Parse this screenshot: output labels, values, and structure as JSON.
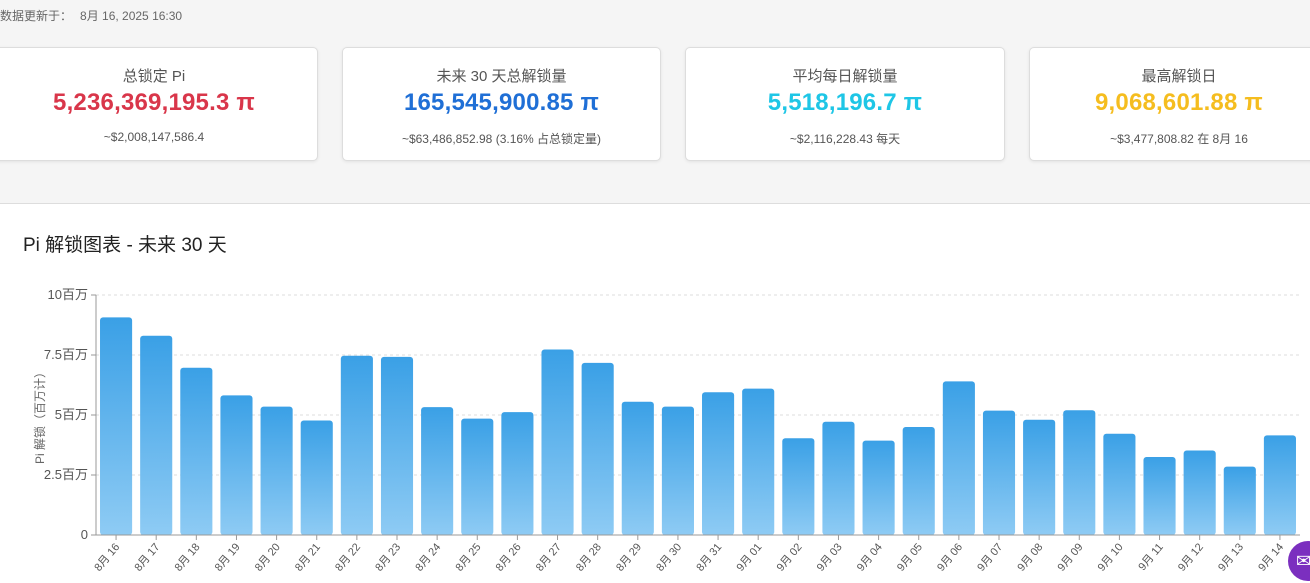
{
  "header": {
    "updated_label": "数据更新于：",
    "updated_time": "8月 16, 2025 16:30"
  },
  "cards": [
    {
      "title": "总锁定 Pi",
      "value": "5,236,369,195.3 π",
      "sub": "~$2,008,147,586.4",
      "color": "#d9364a"
    },
    {
      "title": "未来 30 天总解锁量",
      "value": "165,545,900.85 π",
      "sub": "~$63,486,852.98 (3.16% 占总锁定量)",
      "color": "#1f6fd6"
    },
    {
      "title": "平均每日解锁量",
      "value": "5,518,196.7 π",
      "sub": "~$2,116,228.43 每天",
      "color": "#1ec6e6"
    },
    {
      "title": "最高解锁日",
      "value": "9,068,601.88 π",
      "sub": "~$3,477,808.82 在 8月 16",
      "color": "#f5bd1f"
    }
  ],
  "chart": {
    "title": "Pi 解锁图表 - 未来 30 天"
  },
  "chart_data": {
    "type": "bar",
    "ylabel": "Pi 解锁（百万计）",
    "ylim": [
      0,
      10
    ],
    "yticks": [
      {
        "v": 0,
        "label": "0"
      },
      {
        "v": 2.5,
        "label": "2.5百万"
      },
      {
        "v": 5,
        "label": "5百万"
      },
      {
        "v": 7.5,
        "label": "7.5百万"
      },
      {
        "v": 10,
        "label": "10百万"
      }
    ],
    "grid": true,
    "categories": [
      "8月 16",
      "8月 17",
      "8月 18",
      "8月 19",
      "8月 20",
      "8月 21",
      "8月 22",
      "8月 23",
      "8月 24",
      "8月 25",
      "8月 26",
      "8月 27",
      "8月 28",
      "8月 29",
      "8月 30",
      "8月 31",
      "9月 01",
      "9月 02",
      "9月 03",
      "9月 04",
      "9月 05",
      "9月 06",
      "9月 07",
      "9月 08",
      "9月 09",
      "9月 10",
      "9月 11",
      "9月 12",
      "9月 13",
      "9月 14"
    ],
    "values": [
      9.07,
      8.3,
      6.97,
      5.82,
      5.35,
      4.77,
      7.47,
      7.42,
      5.33,
      4.85,
      5.12,
      7.73,
      7.17,
      5.55,
      5.35,
      5.95,
      6.1,
      4.03,
      4.72,
      3.93,
      4.5,
      6.4,
      5.18,
      4.8,
      5.2,
      4.22,
      3.25,
      3.52,
      2.85,
      4.15
    ],
    "bar_color_top": "#3aa0e6",
    "bar_color_bottom": "#8ecbf4"
  },
  "help_icon": "chat-icon"
}
